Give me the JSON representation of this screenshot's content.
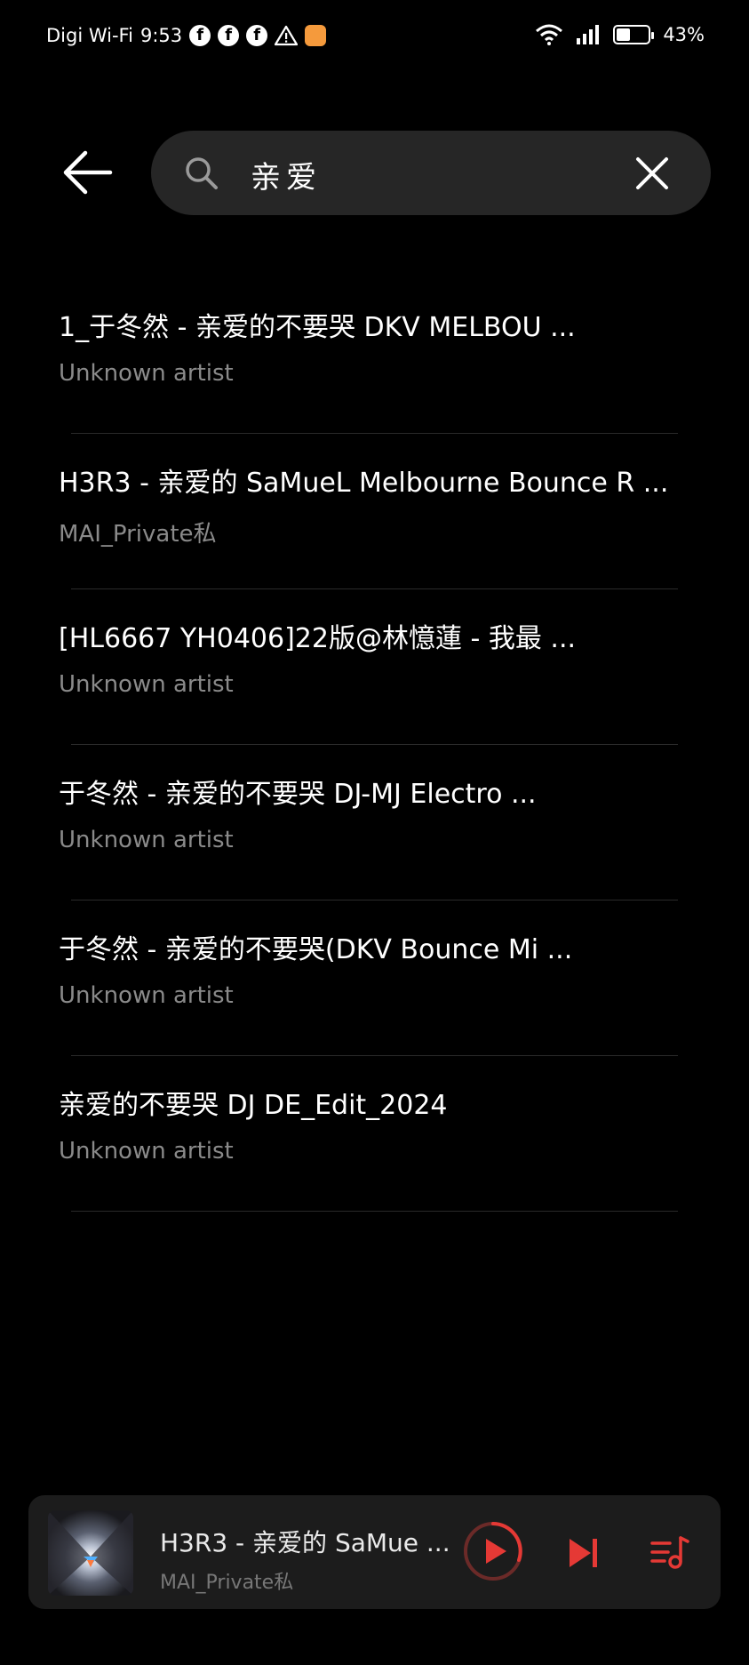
{
  "status_bar": {
    "carrier": "Digi Wi-Fi",
    "time": "9:53",
    "battery": "43%",
    "battery_level": 0.43,
    "icons": [
      "facebook-icon",
      "facebook-icon",
      "facebook-icon",
      "warning-icon",
      "app-notification-icon",
      "wifi-icon",
      "signal-icon",
      "battery-icon"
    ]
  },
  "search": {
    "query": "亲爱",
    "placeholder": ""
  },
  "results": [
    {
      "title": "1_于冬然 - 亲爱的不要哭 DKV MELBOU ...",
      "artist": "Unknown artist"
    },
    {
      "title": "H3R3 - 亲爱的 SaMueL Melbourne Bounce R ...",
      "artist": "MAI_Private私"
    },
    {
      "title": "[HL6667 YH0406]22版@林憶蓮 - 我最 ...",
      "artist": "Unknown artist"
    },
    {
      "title": "于冬然 - 亲爱的不要哭 DJ-MJ Electro ...",
      "artist": "Unknown artist"
    },
    {
      "title": "于冬然 - 亲爱的不要哭(DKV Bounce Mi ...",
      "artist": "Unknown artist"
    },
    {
      "title": "亲爱的不要哭 DJ DE_Edit_2024",
      "artist": "Unknown artist"
    }
  ],
  "now_playing": {
    "title": "H3R3 - 亲爱的 SaMue ...",
    "artist": "MAI_Private私"
  },
  "colors": {
    "accent": "#e53935",
    "background": "#000000",
    "search_bg": "#262626",
    "player_bg": "#1c1c1c",
    "muted_text": "#8a8a8a"
  }
}
